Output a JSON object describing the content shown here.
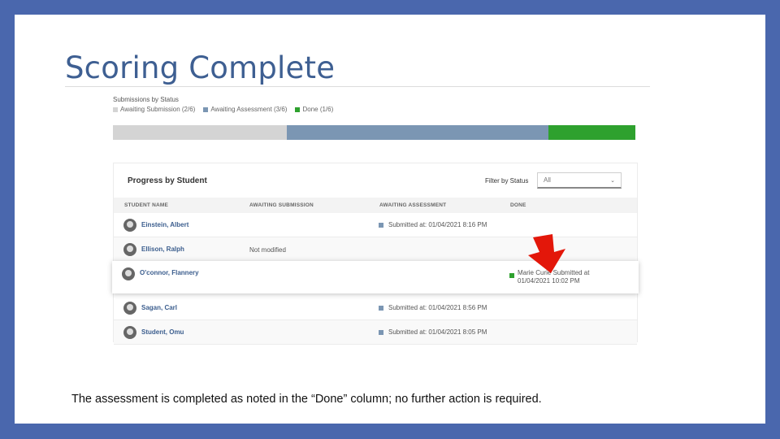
{
  "slide": {
    "title": "Scoring Complete",
    "caption": "The assessment is completed as noted in the “Done” column; no further action is required."
  },
  "status": {
    "heading": "Submissions by Status",
    "legend": [
      {
        "label": "Awaiting Submission (2/6)",
        "color": "#d4d4d4"
      },
      {
        "label": "Awaiting Assessment (3/6)",
        "color": "#7b96b3"
      },
      {
        "label": "Done (1/6)",
        "color": "#2ea12e"
      }
    ],
    "bar": [
      {
        "name": "Awaiting Submission",
        "fraction": 0.333,
        "color": "#d4d4d4"
      },
      {
        "name": "Awaiting Assessment",
        "fraction": 0.5,
        "color": "#7b96b3"
      },
      {
        "name": "Done",
        "fraction": 0.167,
        "color": "#2ea12e"
      }
    ]
  },
  "progress": {
    "title": "Progress by Student",
    "filter_label": "Filter by Status",
    "filter_value": "All",
    "columns": [
      "STUDENT NAME",
      "AWAITING SUBMISSION",
      "AWAITING ASSESSMENT",
      "DONE"
    ],
    "rows": [
      {
        "name": "Einstein, Albert",
        "awaiting_submission": "",
        "awaiting_assessment": "Submitted at: 01/04/2021 8:16 PM",
        "done": ""
      },
      {
        "name": "Ellison, Ralph",
        "awaiting_submission": "Not modified",
        "awaiting_assessment": "",
        "done": ""
      },
      {
        "name": "O'connor, Flannery",
        "awaiting_submission": "",
        "awaiting_assessment": "",
        "done_line1": "Marie Curie Submitted at",
        "done_line2": "01/04/2021 10:02 PM"
      },
      {
        "name": "Sagan, Carl",
        "awaiting_submission": "",
        "awaiting_assessment": "Submitted at: 01/04/2021 8:56 PM",
        "done": ""
      },
      {
        "name": "Student, Omu",
        "awaiting_submission": "",
        "awaiting_assessment": "Submitted at: 01/04/2021 8:05 PM",
        "done": ""
      }
    ],
    "colors": {
      "assessment_marker": "#7b96b3",
      "done_marker": "#2ea12e",
      "arrow": "#e3170a"
    }
  }
}
